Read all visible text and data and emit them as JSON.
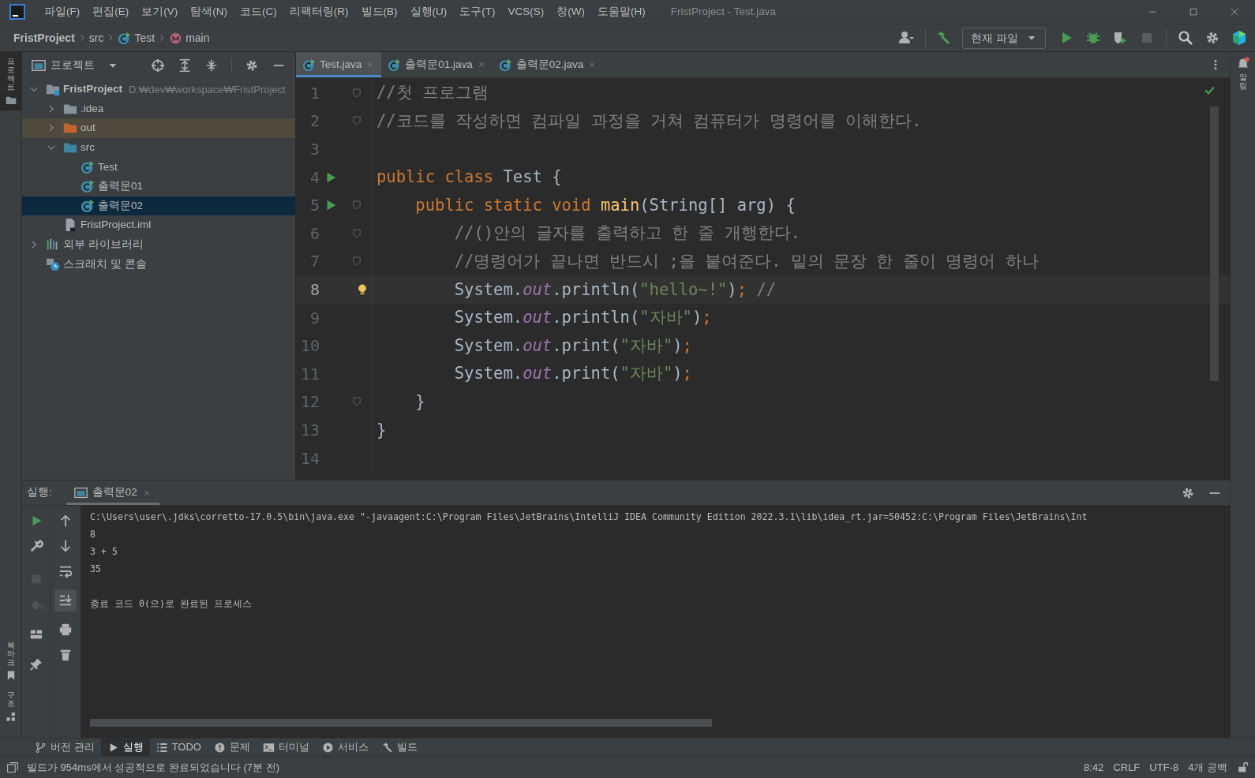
{
  "window": {
    "title": "FristProject - Test.java"
  },
  "menu": [
    "파일(F)",
    "편집(E)",
    "보기(V)",
    "탐색(N)",
    "코드(C)",
    "리팩터링(R)",
    "빌드(B)",
    "실행(U)",
    "도구(T)",
    "VCS(S)",
    "창(W)",
    "도움말(H)"
  ],
  "breadcrumbs": [
    {
      "label": "FristProject",
      "kind": "project"
    },
    {
      "label": "src",
      "kind": "folder"
    },
    {
      "label": "Test",
      "kind": "class"
    },
    {
      "label": "main",
      "kind": "method"
    }
  ],
  "run_config": "현재 파일",
  "left_stripe": [
    {
      "label": "프로젝트",
      "selected": true
    },
    {
      "label": "북마크",
      "selected": false
    },
    {
      "label": "구조",
      "selected": false
    }
  ],
  "right_stripe": [
    {
      "label": "알림"
    }
  ],
  "project_panel": {
    "title": "프로젝트",
    "tree": [
      {
        "label": "FristProject",
        "hint": "D:₩dev₩workspace₩FristProject",
        "kind": "module",
        "expanded": true,
        "selected": false,
        "children": [
          {
            "label": ".idea",
            "kind": "folder",
            "expanded": false,
            "selected": false
          },
          {
            "label": "out",
            "kind": "excluded",
            "expanded": false,
            "selected": false
          },
          {
            "label": "src",
            "kind": "source",
            "expanded": true,
            "selected": false,
            "children": [
              {
                "label": "Test",
                "kind": "class",
                "selected": false
              },
              {
                "label": "출력문01",
                "kind": "class",
                "selected": false
              },
              {
                "label": "출력문02",
                "kind": "class",
                "selected": true
              }
            ]
          },
          {
            "label": "FristProject.iml",
            "kind": "file",
            "selected": false
          }
        ]
      },
      {
        "label": "외부 라이브러리",
        "kind": "library",
        "expanded": false,
        "selected": false
      },
      {
        "label": "스크래치 및 콘솔",
        "kind": "scratch",
        "selected": false
      }
    ]
  },
  "editor_tabs": [
    {
      "label": "Test.java",
      "selected": true
    },
    {
      "label": "출력문01.java",
      "selected": false
    },
    {
      "label": "출력문02.java",
      "selected": false
    }
  ],
  "code": [
    {
      "number": "1",
      "fold": true,
      "tokens": [
        {
          "kind": "comment",
          "text": "//첫 프로그램"
        }
      ]
    },
    {
      "number": "2",
      "fold": true,
      "tokens": [
        {
          "kind": "comment",
          "text": "//코드를 작성하면 컴파일 과정을 거쳐 컴퓨터가 명령어를 이해한다."
        }
      ]
    },
    {
      "number": "3"
    },
    {
      "number": "4",
      "run": true,
      "tokens": [
        {
          "kind": "keyword",
          "text": "public class "
        },
        {
          "kind": "plain",
          "text": "Test {"
        }
      ]
    },
    {
      "number": "5",
      "run": true,
      "fold": true,
      "tokens": [
        {
          "kind": "keyword",
          "text": "    public static void "
        },
        {
          "kind": "method",
          "text": "main"
        },
        {
          "kind": "plain",
          "text": "(String[] arg) {"
        }
      ]
    },
    {
      "number": "6",
      "fold": true,
      "tokens": [
        {
          "kind": "comment",
          "text": "        //()안의 글자를 출력하고 한 줄 개행한다."
        }
      ]
    },
    {
      "number": "7",
      "fold": true,
      "tokens": [
        {
          "kind": "comment",
          "text": "        //명령어가 끝나면 반드시 ;을 붙여준다. 밑의 문장 한 줄이 명령어 하나"
        }
      ]
    },
    {
      "number": "8",
      "current": true,
      "bulb": true,
      "tokens": [
        {
          "kind": "plain",
          "text": "        System."
        },
        {
          "kind": "field",
          "text": "out"
        },
        {
          "kind": "plain",
          "text": ".println("
        },
        {
          "kind": "string",
          "text": "\"hello~!\""
        },
        {
          "kind": "plain",
          "text": ")"
        },
        {
          "kind": "keyword",
          "text": ";"
        },
        {
          "kind": "comment",
          "text": " //"
        }
      ]
    },
    {
      "number": "9",
      "tokens": [
        {
          "kind": "plain",
          "text": "        System."
        },
        {
          "kind": "field",
          "text": "out"
        },
        {
          "kind": "plain",
          "text": ".println("
        },
        {
          "kind": "string",
          "text": "\"자바\""
        },
        {
          "kind": "plain",
          "text": ")"
        },
        {
          "kind": "keyword",
          "text": ";"
        }
      ]
    },
    {
      "number": "10",
      "tokens": [
        {
          "kind": "plain",
          "text": "        System."
        },
        {
          "kind": "field",
          "text": "out"
        },
        {
          "kind": "plain",
          "text": ".print("
        },
        {
          "kind": "string",
          "text": "\"자바\""
        },
        {
          "kind": "plain",
          "text": ")"
        },
        {
          "kind": "keyword",
          "text": ";"
        }
      ]
    },
    {
      "number": "11",
      "tokens": [
        {
          "kind": "plain",
          "text": "        System."
        },
        {
          "kind": "field",
          "text": "out"
        },
        {
          "kind": "plain",
          "text": ".print("
        },
        {
          "kind": "string",
          "text": "\"자바\""
        },
        {
          "kind": "plain",
          "text": ")"
        },
        {
          "kind": "keyword",
          "text": ";"
        }
      ]
    },
    {
      "number": "12",
      "fold": true,
      "tokens": [
        {
          "kind": "plain",
          "text": "    }"
        }
      ]
    },
    {
      "number": "13",
      "tokens": [
        {
          "kind": "plain",
          "text": "}"
        }
      ]
    },
    {
      "number": "14"
    }
  ],
  "run_panel": {
    "label": "실행:",
    "tabs": [
      {
        "label": "출력문02",
        "selected": true
      }
    ],
    "console": [
      {
        "text": "C:\\Users\\user\\.jdks\\corretto-17.0.5\\bin\\java.exe \"-javaagent:C:\\Program Files\\JetBrains\\IntelliJ IDEA Community Edition 2022.3.1\\lib\\idea_rt.jar=50452:C:\\Program Files\\JetBrains\\Int"
      },
      {
        "text": "8"
      },
      {
        "text": "3 + 5"
      },
      {
        "text": "35"
      },
      {
        "text": "종료 코드 0(으)로 완료된 프로세스",
        "spaced": true
      }
    ]
  },
  "tool_buttons": [
    {
      "label": "버전 관리",
      "kind": "vcs",
      "selected": false
    },
    {
      "label": "실행",
      "kind": "run",
      "selected": true
    },
    {
      "label": "TODO",
      "kind": "todo",
      "selected": false
    },
    {
      "label": "문제",
      "kind": "problems",
      "selected": false
    },
    {
      "label": "터미널",
      "kind": "terminal",
      "selected": false
    },
    {
      "label": "서비스",
      "kind": "services",
      "selected": false
    },
    {
      "label": "빌드",
      "kind": "build",
      "selected": false
    }
  ],
  "status_bar": {
    "message": "빌드가 954ms에서 성공적으로 완료되었습니다 (7분 전)",
    "items": [
      "8:42",
      "CRLF",
      "UTF-8",
      "4개 공백"
    ]
  }
}
